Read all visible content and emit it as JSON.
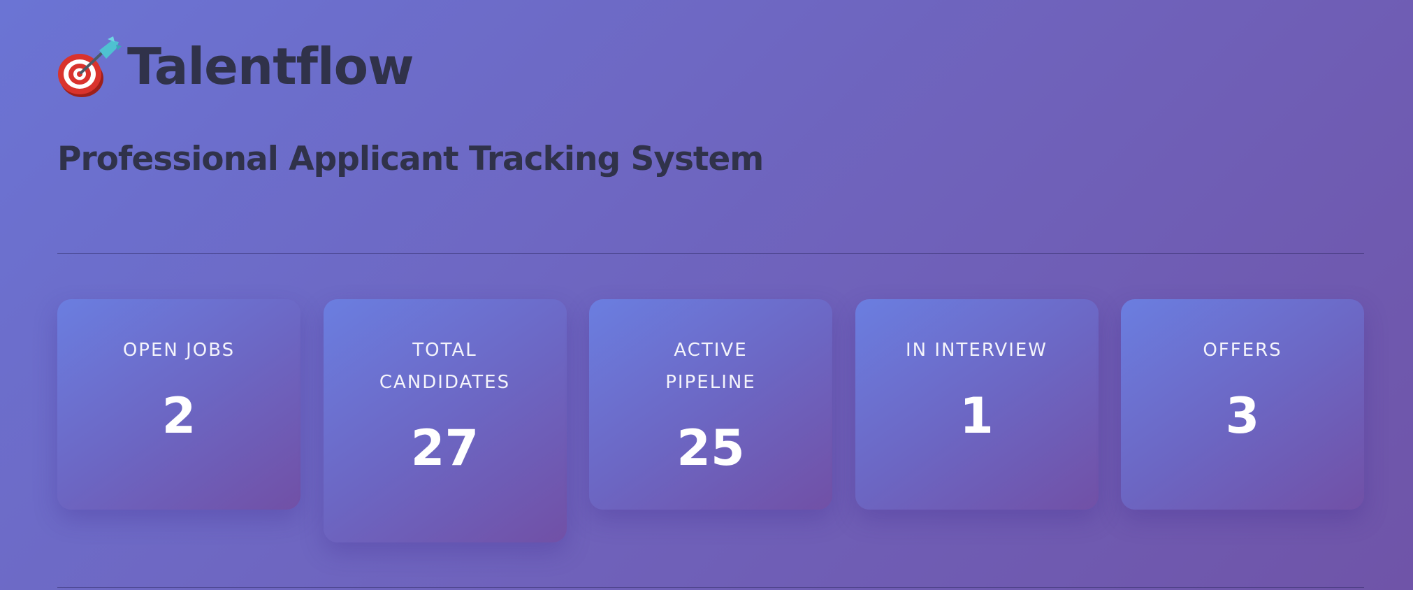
{
  "header": {
    "logo_icon": "dart-target-icon",
    "title": "Talentflow",
    "subtitle": "Professional Applicant Tracking System"
  },
  "stats": [
    {
      "label": "OPEN JOBS",
      "value": "2"
    },
    {
      "label": "TOTAL CANDIDATES",
      "value": "27"
    },
    {
      "label": "ACTIVE PIPELINE",
      "value": "25"
    },
    {
      "label": "IN INTERVIEW",
      "value": "1"
    },
    {
      "label": "OFFERS",
      "value": "3"
    }
  ],
  "colors": {
    "background_start": "#6b74d4",
    "background_end": "#6f54a8",
    "title_text": "#30324a",
    "card_text": "#ffffff"
  }
}
